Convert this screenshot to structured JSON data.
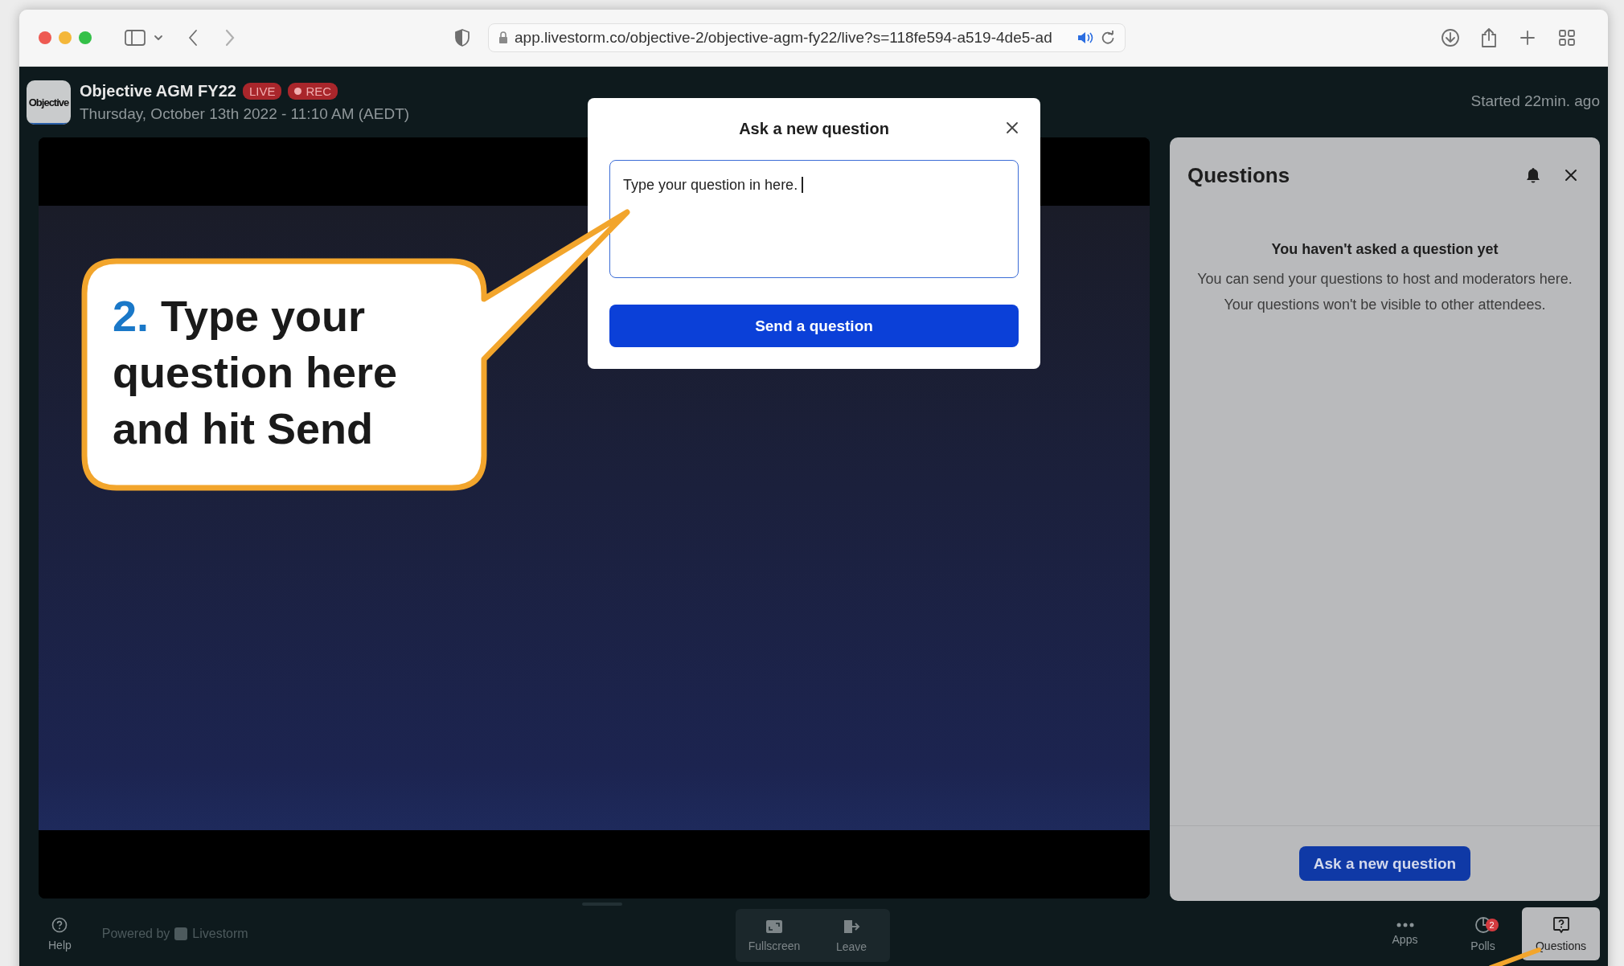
{
  "browser": {
    "url": "app.livestorm.co/objective-2/objective-agm-fy22/live?s=118fe594-a519-4de5-ad"
  },
  "event": {
    "logo_text": "Objective",
    "title": "Objective AGM FY22",
    "badges": [
      {
        "label": "LIVE",
        "kind": "live"
      },
      {
        "label": "REC",
        "kind": "rec"
      }
    ],
    "date": "Thursday, October 13th 2022 - 11:10 AM (AEDT)",
    "started": "Started 22min. ago"
  },
  "modal": {
    "title": "Ask a new question",
    "value": "Type your question in here.",
    "button": "Send a question"
  },
  "questions_panel": {
    "title": "Questions",
    "empty_title": "You haven't asked a question yet",
    "empty_text": "You can send your questions to host and moderators here. Your questions won't be visible to other attendees.",
    "button": "Ask a new question"
  },
  "toolbar": {
    "help": "Help",
    "powered_by": "Powered by",
    "brand": "Livestorm",
    "center_items": [
      {
        "label": "Fullscreen",
        "kind": "fullscreen"
      },
      {
        "label": "Leave",
        "kind": "leave"
      }
    ],
    "right_items": [
      {
        "label": "Apps",
        "kind": "apps",
        "selected": false
      },
      {
        "label": "Polls",
        "kind": "polls",
        "badge": "2",
        "selected": false
      },
      {
        "label": "Questions",
        "kind": "questions",
        "selected": true
      }
    ]
  },
  "callout": {
    "number": "2.",
    "text": "Type your question here and hit Send"
  }
}
